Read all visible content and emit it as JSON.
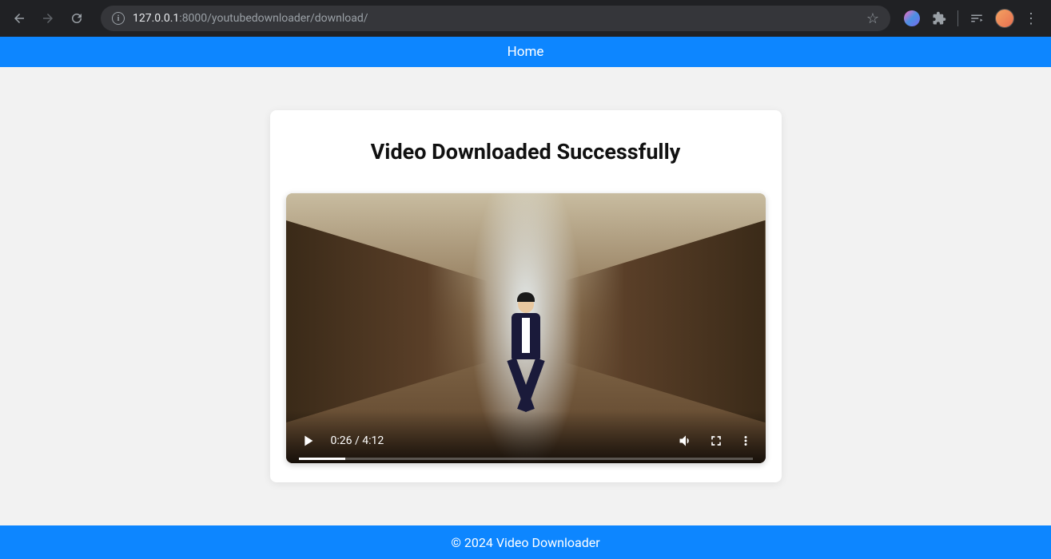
{
  "browser": {
    "url_host": "127.0.0.1",
    "url_path": ":8000/youtubedownloader/download/"
  },
  "nav": {
    "home_label": "Home"
  },
  "card": {
    "title": "Video Downloaded Successfully"
  },
  "video": {
    "current_time": "0:26",
    "duration": "4:12",
    "time_combined": "0:26 / 4:12"
  },
  "footer": {
    "text": "© 2024 Video Downloader"
  }
}
